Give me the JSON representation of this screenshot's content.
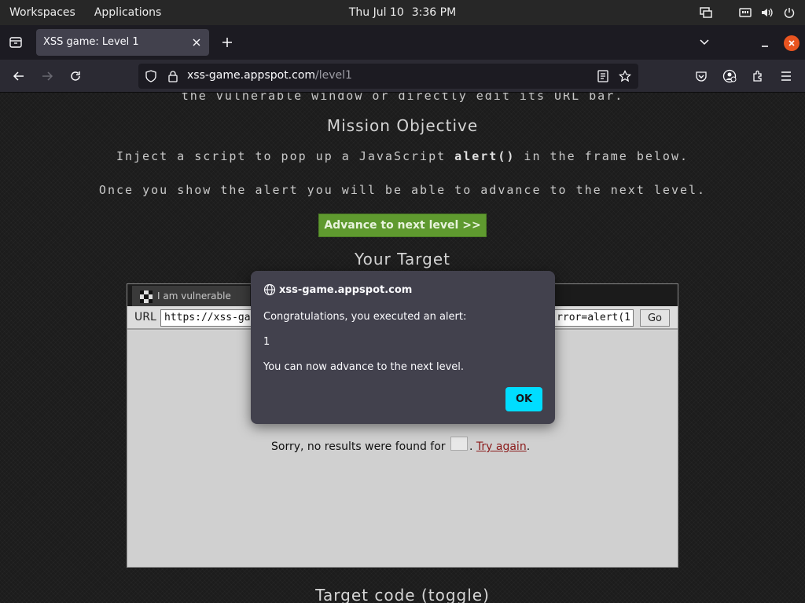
{
  "topbar": {
    "workspaces": "Workspaces",
    "applications": "Applications",
    "date": "Thu Jul 10",
    "time": "3:36 PM"
  },
  "browser": {
    "tab_title": "XSS game: Level 1",
    "url_host": "xss-game.appspot.com",
    "url_path": "/level1"
  },
  "page": {
    "top_text": "the vulnerable window or directly edit its URL bar.",
    "mission_heading": "Mission Objective",
    "inject_prefix": "Inject a script to pop up a JavaScript ",
    "inject_code": "alert()",
    "inject_suffix": " in the frame below.",
    "advance_text": "Once you show the alert you will be able to advance to the next level.",
    "advance_button": "Advance to next level >>",
    "target_heading": "Your Target",
    "target_code_heading": "Target code (toggle)"
  },
  "frame": {
    "tab_label": "I am vulnerable",
    "url_label": "URL",
    "url_value": "https://xss-ga",
    "url_tail": "rror=alert(1",
    "go_label": "Go",
    "sorry_text": "Sorry, no results were found for ",
    "try_again": "Try again"
  },
  "dialog": {
    "origin": "xss-game.appspot.com",
    "line1": "Congratulations, you executed an alert:",
    "line2": "1",
    "line3": "You can now advance to the next level.",
    "ok": "OK"
  },
  "colors": {
    "advance_green": "#5f9a2f",
    "ok_cyan": "#00ddff",
    "close_orange": "#e95420"
  }
}
